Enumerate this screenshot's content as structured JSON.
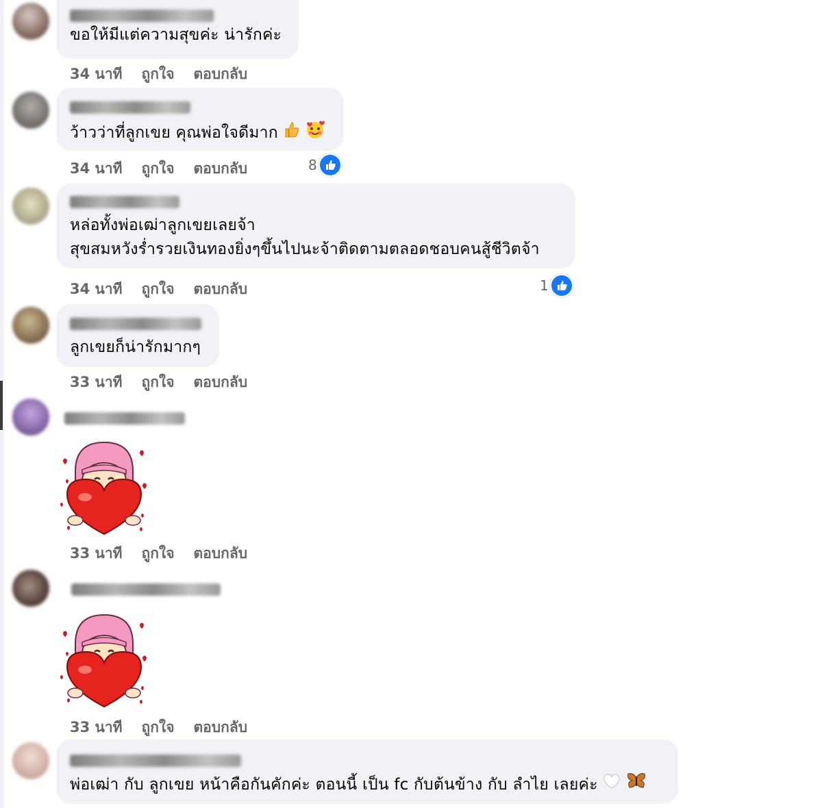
{
  "actions": {
    "like": "ถูกใจ",
    "reply": "ตอบกลับ"
  },
  "comments": [
    {
      "text": "ขอให้มีแต่ความสุขค่ะ น่ารักค่ะ",
      "time": "34 นาที"
    },
    {
      "text": "ว้าวว่าที่ลูกเขย คุณพ่อใจดีมาก",
      "time": "34 นาที",
      "reactions": "8",
      "emojis": [
        "thumbs-up",
        "smiling-face-with-hearts"
      ]
    },
    {
      "lines": [
        "หล่อทั้งพ่อเฒ่าลูกเขยเลยจ้า",
        "สุขสมหวังร่ำรวยเงินทองยิ่งๆขึ้นไปนะจ้าติดตามตลอดชอบคนสู้ชีวิตจ้า"
      ],
      "time": "34 นาที",
      "reactions": "1"
    },
    {
      "text": "ลูกเขยก็น่ารักมากๆ",
      "time": "33 นาที"
    },
    {
      "sticker": "girl-hugging-heart",
      "time": "33 นาที"
    },
    {
      "sticker": "girl-hugging-heart",
      "time": "33 นาที"
    },
    {
      "text": "พ่อเฒ่า กับ ลูกเขย หน้าคือกันคักค่ะ ตอนนี้ เป็น fc กับต้นข้าง กับ ลำไย เลยค่ะ",
      "emojis": [
        "white-heart",
        "butterfly"
      ]
    }
  ],
  "colors": {
    "bubble": "#f0f2f5",
    "meta": "#65676b",
    "like": "#1877f2"
  }
}
